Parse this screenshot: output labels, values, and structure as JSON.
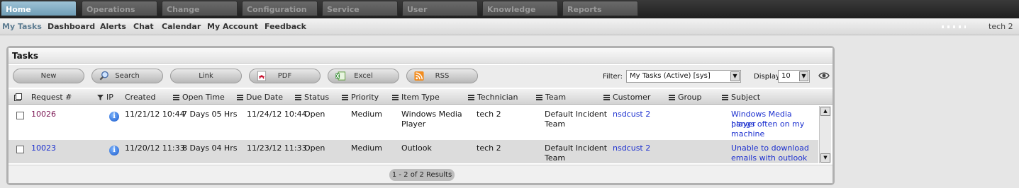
{
  "topnav": {
    "tabs": [
      "Home",
      "Operations",
      "Change",
      "Configuration",
      "Service",
      "User",
      "Knowledge",
      "Reports"
    ],
    "active": "Home"
  },
  "subnav": {
    "items": [
      "My Tasks",
      "Dashboard",
      "Alerts",
      "Chat",
      "Calendar",
      "My Account",
      "Feedback"
    ],
    "active": "My Tasks",
    "user": "tech 2"
  },
  "panel": {
    "title": "Tasks",
    "buttons": {
      "new": "New",
      "search": "Search",
      "link": "Link",
      "pdf": "PDF",
      "excel": "Excel",
      "rss": "RSS"
    },
    "filter_label": "Filter:",
    "filter_value": "My Tasks (Active) [sys]",
    "display_label": "Display:",
    "display_value": "10"
  },
  "table": {
    "columns": {
      "request": "Request #",
      "ip": "IP",
      "created": "Created",
      "open_time": "Open Time",
      "due_date": "Due Date",
      "status": "Status",
      "priority": "Priority",
      "item_type": "Item Type",
      "technician": "Technician",
      "team": "Team",
      "customer": "Customer",
      "group": "Group",
      "subject": "Subject"
    },
    "rows": [
      {
        "request": "10026",
        "created": "11/21/12 10:44",
        "open_time": "7 Days 05 Hrs",
        "due_date": "11/24/12 10:44",
        "status": "Open",
        "priority": "Medium",
        "item_type_1": "Windows Media",
        "item_type_2": "Player",
        "technician": "tech 2",
        "team_1": "Default Incident",
        "team_2": "Team",
        "customer": "nsdcust 2",
        "group": "",
        "subject_1": "Windows Media player",
        "subject_2": "hangs often on my",
        "subject_3": "machine"
      },
      {
        "request": "10023",
        "created": "11/20/12 11:33",
        "open_time": "8 Days 04 Hrs",
        "due_date": "11/23/12 11:33",
        "status": "Open",
        "priority": "Medium",
        "item_type_1": "Outlook",
        "item_type_2": "",
        "technician": "tech 2",
        "team_1": "Default Incident",
        "team_2": "Team",
        "customer": "nsdcust 2",
        "group": "",
        "subject_1": "Unable to download",
        "subject_2": "emails with outlook",
        "subject_3": ""
      }
    ],
    "results": "1 - 2 of 2 Results"
  },
  "colors": {
    "active_tab": "#6f9db6",
    "link": "#1b2fcf",
    "visited_link": "#7b1452"
  }
}
